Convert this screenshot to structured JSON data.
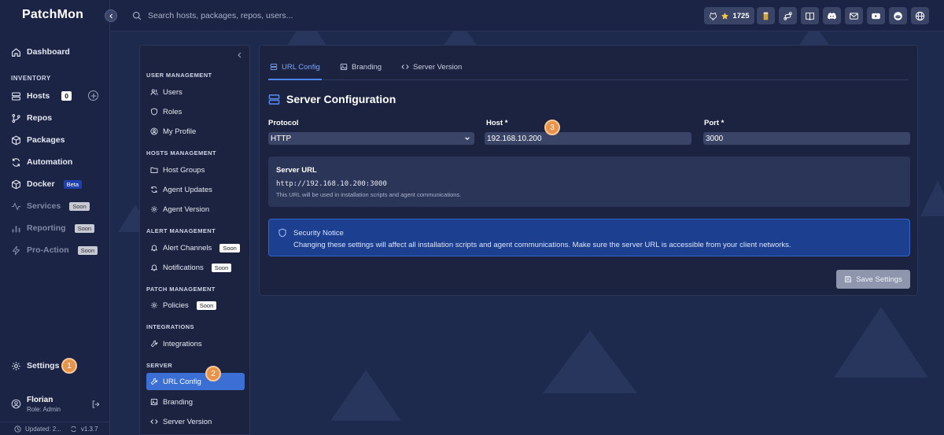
{
  "app": {
    "logo": "PatchMon"
  },
  "search": {
    "placeholder": "Search hosts, packages, repos, users..."
  },
  "topbar": {
    "github_stars": "1725"
  },
  "sidebar": {
    "dashboard": "Dashboard",
    "inventory_label": "INVENTORY",
    "hosts": "Hosts",
    "hosts_count": "0",
    "repos": "Repos",
    "packages": "Packages",
    "automation": "Automation",
    "docker": "Docker",
    "docker_badge": "Beta",
    "services": "Services",
    "reporting": "Reporting",
    "pro_action": "Pro-Action",
    "soon": "Soon",
    "settings": "Settings",
    "user_name": "Florian",
    "user_role": "Role: Admin",
    "updated": "Updated: 2...",
    "version": "v1.3.7"
  },
  "markers": {
    "one": "1",
    "two": "2",
    "three": "3"
  },
  "subnav": {
    "user_management": "USER MANAGEMENT",
    "users": "Users",
    "roles": "Roles",
    "my_profile": "My Profile",
    "hosts_management": "HOSTS MANAGEMENT",
    "host_groups": "Host Groups",
    "agent_updates": "Agent Updates",
    "agent_version": "Agent Version",
    "alert_management": "ALERT MANAGEMENT",
    "alert_channels": "Alert Channels",
    "notifications": "Notifications",
    "patch_management": "PATCH MANAGEMENT",
    "policies": "Policies",
    "integrations_label": "INTEGRATIONS",
    "integrations": "Integrations",
    "server_label": "SERVER",
    "url_config": "URL Config",
    "branding": "Branding",
    "server_version": "Server Version",
    "soon": "Soon"
  },
  "main": {
    "tabs": [
      {
        "label": "URL Config"
      },
      {
        "label": "Branding"
      },
      {
        "label": "Server Version"
      }
    ],
    "title": "Server Configuration",
    "protocol_label": "Protocol",
    "protocol_value": "HTTP",
    "host_label": "Host *",
    "host_value": "192.168.10.200",
    "port_label": "Port *",
    "port_value": "3000",
    "server_url_title": "Server URL",
    "server_url_value": "http://192.168.10.200:3000",
    "server_url_note": "This URL will be used in installation scripts and agent communications.",
    "notice_title": "Security Notice",
    "notice_text": "Changing these settings will affect all installation scripts and agent communications. Make sure the server URL is accessible from your client networks.",
    "save_label": "Save Settings"
  },
  "colors": {
    "accent": "#3b6fd4",
    "marker": "#e8934a",
    "notice_bg": "#1c3f8f"
  }
}
